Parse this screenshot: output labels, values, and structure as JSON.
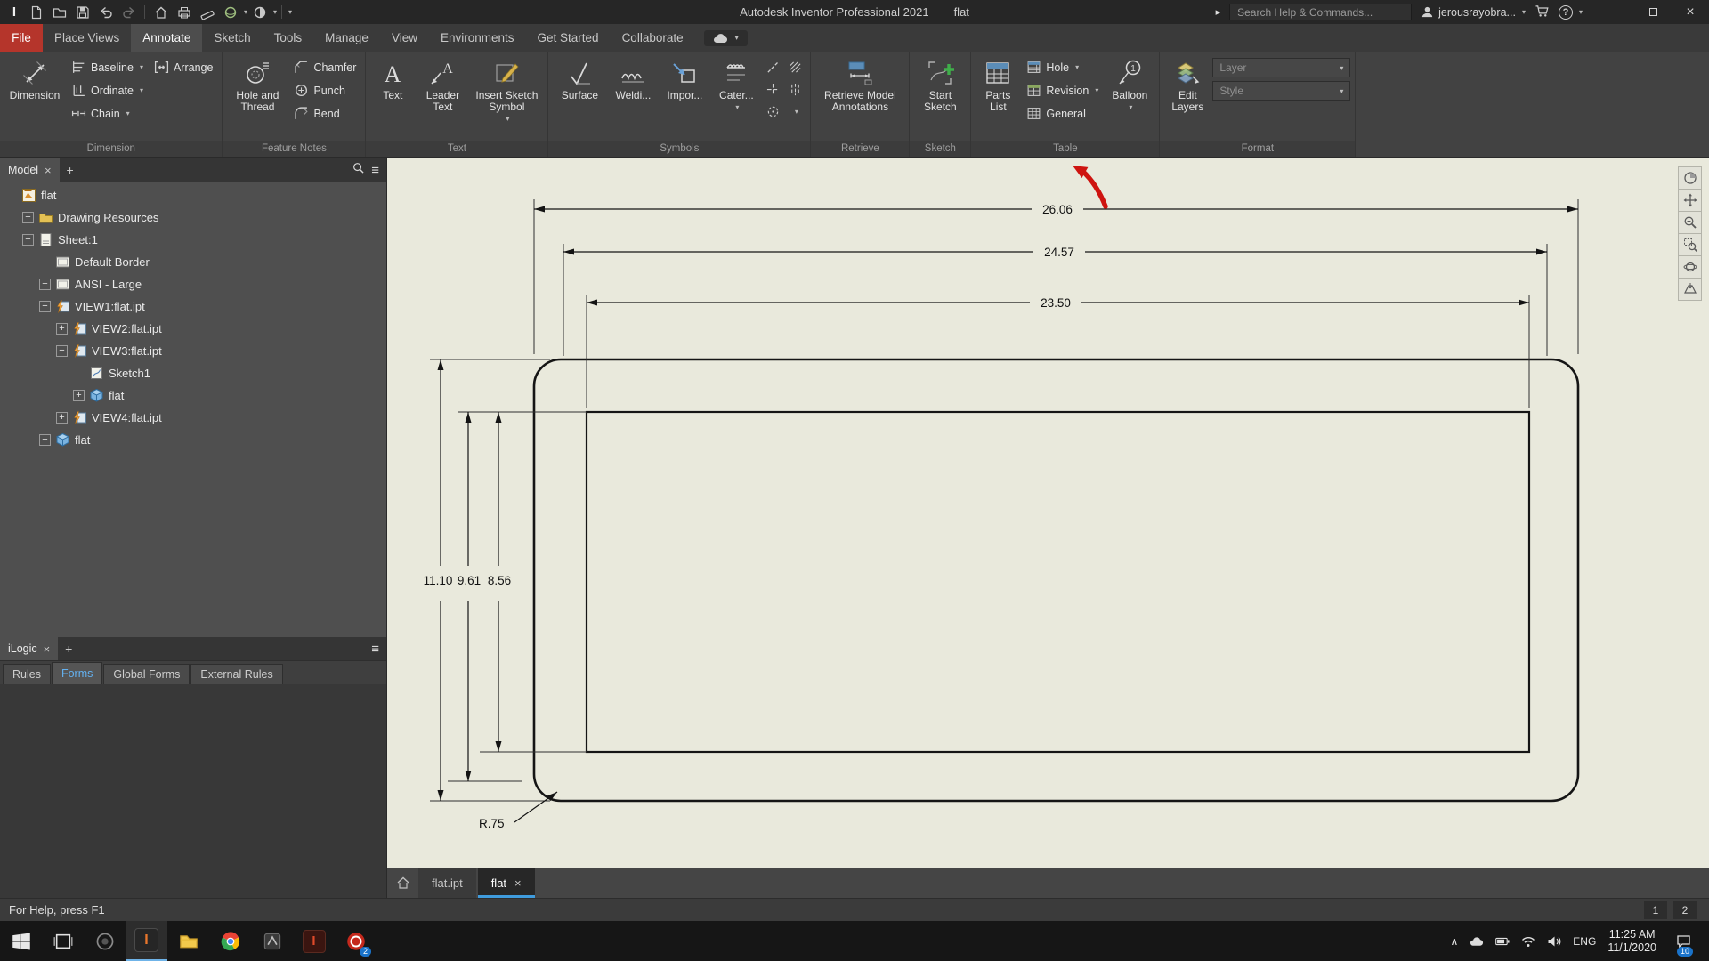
{
  "titlebar": {
    "app_title": "Autodesk Inventor Professional 2021",
    "doc_name": "flat",
    "search_placeholder": "Search Help & Commands...",
    "user_name": "jerousrayobra..."
  },
  "menu": {
    "file": "File",
    "tabs": [
      {
        "label": "Place Views",
        "active": false
      },
      {
        "label": "Annotate",
        "active": true
      },
      {
        "label": "Sketch",
        "active": false
      },
      {
        "label": "Tools",
        "active": false
      },
      {
        "label": "Manage",
        "active": false
      },
      {
        "label": "View",
        "active": false
      },
      {
        "label": "Environments",
        "active": false
      },
      {
        "label": "Get Started",
        "active": false
      },
      {
        "label": "Collaborate",
        "active": false
      }
    ]
  },
  "ribbon": {
    "dimension": {
      "large": "Dimension",
      "baseline": "Baseline",
      "ordinate": "Ordinate",
      "chain": "Chain",
      "arrange": "Arrange",
      "label": "Dimension"
    },
    "feature_notes": {
      "large": "Hole and Thread",
      "chamfer": "Chamfer",
      "punch": "Punch",
      "bend": "Bend",
      "label": "Feature Notes"
    },
    "text": {
      "text": "Text",
      "leader": "Leader Text",
      "insert": "Insert Sketch Symbol",
      "label": "Text"
    },
    "symbols": {
      "surface": "Surface",
      "weld": "Weldi...",
      "import": "Impor...",
      "caterpillar": "Cater...",
      "label": "Symbols"
    },
    "retrieve": {
      "large": "Retrieve Model Annotations",
      "label": "Retrieve"
    },
    "sketch": {
      "large": "Start Sketch",
      "label": "Sketch"
    },
    "table": {
      "parts_list": "Parts List",
      "hole": "Hole",
      "revision": "Revision",
      "general": "General",
      "balloon": "Balloon",
      "label": "Table"
    },
    "format": {
      "edit_layers": "Edit Layers",
      "layer": "Layer",
      "style": "Style",
      "label": "Format"
    }
  },
  "model_panel": {
    "tab": "Model",
    "tree": [
      {
        "level": 0,
        "toggle": "",
        "icon": "drawing",
        "label": "flat"
      },
      {
        "level": 1,
        "toggle": "+",
        "icon": "folder",
        "label": "Drawing Resources"
      },
      {
        "level": 1,
        "toggle": "-",
        "icon": "sheet",
        "label": "Sheet:1"
      },
      {
        "level": 2,
        "toggle": "",
        "icon": "border",
        "label": "Default Border"
      },
      {
        "level": 2,
        "toggle": "+",
        "icon": "border",
        "label": "ANSI - Large"
      },
      {
        "level": 2,
        "toggle": "-",
        "icon": "view",
        "label": "VIEW1:flat.ipt"
      },
      {
        "level": 3,
        "toggle": "+",
        "icon": "view",
        "label": "VIEW2:flat.ipt"
      },
      {
        "level": 3,
        "toggle": "-",
        "icon": "view",
        "label": "VIEW3:flat.ipt"
      },
      {
        "level": 4,
        "toggle": "",
        "icon": "sketch",
        "label": "Sketch1"
      },
      {
        "level": 4,
        "toggle": "+",
        "icon": "part",
        "label": "flat"
      },
      {
        "level": 3,
        "toggle": "+",
        "icon": "view",
        "label": "VIEW4:flat.ipt"
      },
      {
        "level": 2,
        "toggle": "+",
        "icon": "part",
        "label": "flat"
      }
    ]
  },
  "ilogic": {
    "tab": "iLogic",
    "tabs": [
      {
        "label": "Rules",
        "active": false
      },
      {
        "label": "Forms",
        "active": true
      },
      {
        "label": "Global Forms",
        "active": false
      },
      {
        "label": "External Rules",
        "active": false
      }
    ]
  },
  "canvas": {
    "dims": {
      "w1": "26.06",
      "w2": "24.57",
      "w3": "23.50",
      "h1": "11.10",
      "h2": "9.61",
      "h3": "8.56",
      "radius": "R.75"
    },
    "file_tabs": [
      {
        "label": "flat.ipt",
        "active": false
      },
      {
        "label": "flat",
        "active": true
      }
    ]
  },
  "status": {
    "help": "For Help, press F1",
    "pages": [
      "1",
      "2"
    ]
  },
  "taskbar": {
    "lang": "ENG",
    "time": "11:25 AM",
    "date": "11/1/2020",
    "notif_badge": "10",
    "mail_badge": "2"
  }
}
